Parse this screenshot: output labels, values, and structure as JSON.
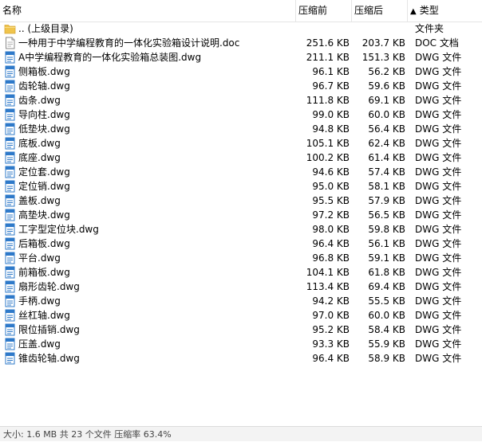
{
  "header": {
    "name": "名称",
    "before": "压缩前",
    "after": "压缩后",
    "type": "类型",
    "sort_indicator": "▲"
  },
  "parent": {
    "name": ".. (上级目录)",
    "type": "文件夹"
  },
  "files": [
    {
      "name": "一种用于中学编程教育的一体化实验箱设计说明.doc",
      "before": "251.6 KB",
      "after": "203.7 KB",
      "type": "DOC 文档",
      "icon": "doc-file-icon"
    },
    {
      "name": "A中学编程教育的一体化实验箱总装图.dwg",
      "before": "211.1 KB",
      "after": "151.3 KB",
      "type": "DWG 文件",
      "icon": "dwg-file-icon"
    },
    {
      "name": "侧箱板.dwg",
      "before": "96.1 KB",
      "after": "56.2 KB",
      "type": "DWG 文件",
      "icon": "dwg-file-icon"
    },
    {
      "name": "齿轮轴.dwg",
      "before": "96.7 KB",
      "after": "59.6 KB",
      "type": "DWG 文件",
      "icon": "dwg-file-icon"
    },
    {
      "name": "齿条.dwg",
      "before": "111.8 KB",
      "after": "69.1 KB",
      "type": "DWG 文件",
      "icon": "dwg-file-icon"
    },
    {
      "name": "导向柱.dwg",
      "before": "99.0 KB",
      "after": "60.0 KB",
      "type": "DWG 文件",
      "icon": "dwg-file-icon"
    },
    {
      "name": "低垫块.dwg",
      "before": "94.8 KB",
      "after": "56.4 KB",
      "type": "DWG 文件",
      "icon": "dwg-file-icon"
    },
    {
      "name": "底板.dwg",
      "before": "105.1 KB",
      "after": "62.4 KB",
      "type": "DWG 文件",
      "icon": "dwg-file-icon"
    },
    {
      "name": "底座.dwg",
      "before": "100.2 KB",
      "after": "61.4 KB",
      "type": "DWG 文件",
      "icon": "dwg-file-icon"
    },
    {
      "name": "定位套.dwg",
      "before": "94.6 KB",
      "after": "57.4 KB",
      "type": "DWG 文件",
      "icon": "dwg-file-icon"
    },
    {
      "name": "定位销.dwg",
      "before": "95.0 KB",
      "after": "58.1 KB",
      "type": "DWG 文件",
      "icon": "dwg-file-icon"
    },
    {
      "name": "盖板.dwg",
      "before": "95.5 KB",
      "after": "57.9 KB",
      "type": "DWG 文件",
      "icon": "dwg-file-icon"
    },
    {
      "name": "高垫块.dwg",
      "before": "97.2 KB",
      "after": "56.5 KB",
      "type": "DWG 文件",
      "icon": "dwg-file-icon"
    },
    {
      "name": "工字型定位块.dwg",
      "before": "98.0 KB",
      "after": "59.8 KB",
      "type": "DWG 文件",
      "icon": "dwg-file-icon"
    },
    {
      "name": "后箱板.dwg",
      "before": "96.4 KB",
      "after": "56.1 KB",
      "type": "DWG 文件",
      "icon": "dwg-file-icon"
    },
    {
      "name": "平台.dwg",
      "before": "96.8 KB",
      "after": "59.1 KB",
      "type": "DWG 文件",
      "icon": "dwg-file-icon"
    },
    {
      "name": "前箱板.dwg",
      "before": "104.1 KB",
      "after": "61.8 KB",
      "type": "DWG 文件",
      "icon": "dwg-file-icon"
    },
    {
      "name": "扇形齿轮.dwg",
      "before": "113.4 KB",
      "after": "69.4 KB",
      "type": "DWG 文件",
      "icon": "dwg-file-icon"
    },
    {
      "name": "手柄.dwg",
      "before": "94.2 KB",
      "after": "55.5 KB",
      "type": "DWG 文件",
      "icon": "dwg-file-icon"
    },
    {
      "name": "丝杠轴.dwg",
      "before": "97.0 KB",
      "after": "60.0 KB",
      "type": "DWG 文件",
      "icon": "dwg-file-icon"
    },
    {
      "name": "限位插销.dwg",
      "before": "95.2 KB",
      "after": "58.4 KB",
      "type": "DWG 文件",
      "icon": "dwg-file-icon"
    },
    {
      "name": "压盖.dwg",
      "before": "93.3 KB",
      "after": "55.9 KB",
      "type": "DWG 文件",
      "icon": "dwg-file-icon"
    },
    {
      "name": "锥齿轮轴.dwg",
      "before": "96.4 KB",
      "after": "58.9 KB",
      "type": "DWG 文件",
      "icon": "dwg-file-icon"
    }
  ],
  "status": {
    "text": "大小: 1.6 MB 共 23 个文件 压缩率 63.4%"
  },
  "colors": {
    "folder": "#f0c44c",
    "dwg_blue": "#2e79c9",
    "doc_gray": "#8a8a8a",
    "hover": "#e5f3ff"
  }
}
